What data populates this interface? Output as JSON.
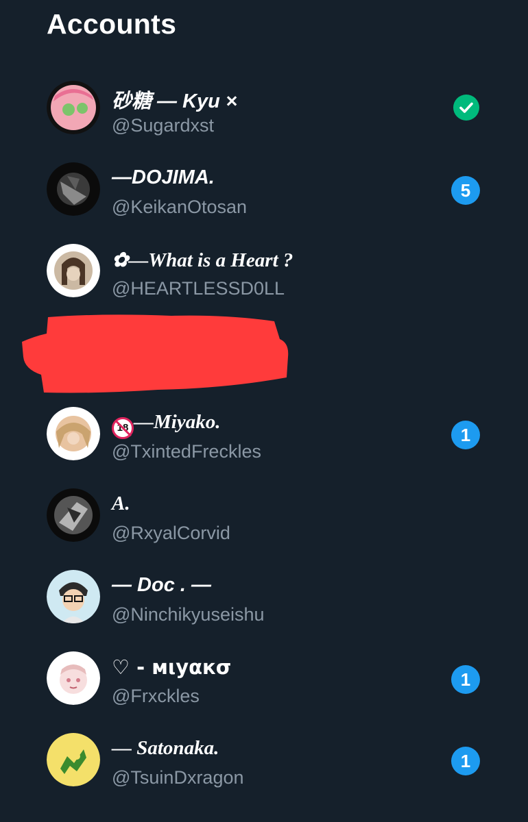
{
  "page": {
    "title": "Accounts"
  },
  "accounts": [
    {
      "name": "砂糖 — Kyu ×",
      "handle": "@Sugardxst",
      "status": "active",
      "badge": ""
    },
    {
      "name": "—DOJIMA.",
      "handle": "@KeikanOtosan",
      "status": "notifications",
      "badge": "5"
    },
    {
      "name": "✿—What is a Heart ?",
      "handle": "@HEARTLESSD0LL",
      "status": "none",
      "badge": ""
    },
    {
      "name": "—Miyako.",
      "handle": "@TxintedFreckles",
      "status": "notifications",
      "badge": "1",
      "emoji": "18"
    },
    {
      "name": "A.",
      "handle": "@RxyalCorvid",
      "status": "none",
      "badge": ""
    },
    {
      "name": "— Doc . —",
      "handle": "@Ninchikyuseishu",
      "status": "none",
      "badge": ""
    },
    {
      "name": "♡ - мιуαкσ",
      "handle": "@Frxckles",
      "status": "notifications",
      "badge": "1"
    },
    {
      "name": "— Satonaka.",
      "handle": "@TsuinDxragon",
      "status": "notifications",
      "badge": "1"
    }
  ],
  "colors": {
    "background": "#15202b",
    "primary_text": "#ffffff",
    "secondary_text": "#8b98a5",
    "badge": "#1d9bf0",
    "active_check": "#00ba7c",
    "redaction": "#ff3b3b"
  },
  "icons": {
    "active": "check-icon",
    "redaction": "redaction-scribble"
  }
}
